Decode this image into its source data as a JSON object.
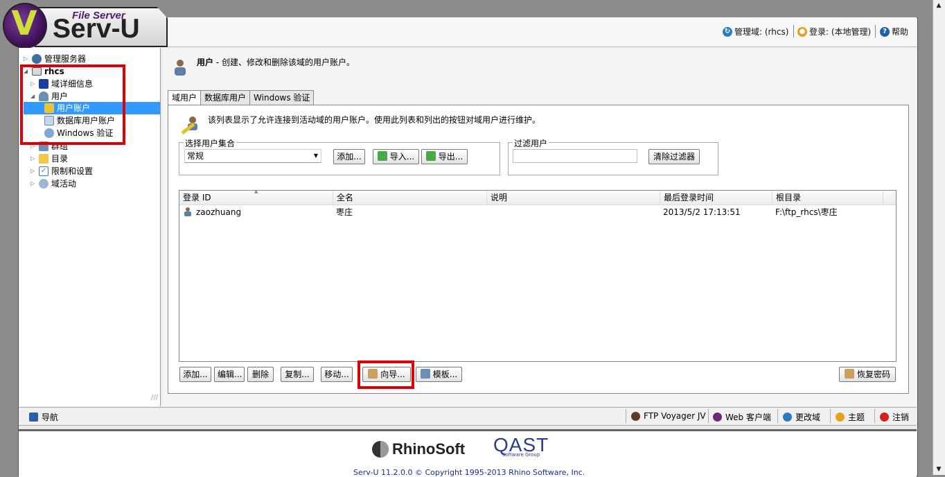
{
  "app": {
    "logo_small": "File Server",
    "logo_big": "Serv-U"
  },
  "header": {
    "domain_label": "管理域: (rhcs)",
    "login_label": "登录: (本地管理)",
    "help_label": "帮助"
  },
  "tree": {
    "items": [
      {
        "label": "管理服务器",
        "icon": "server-icon"
      },
      {
        "label": "rhcs",
        "icon": "domain-icon"
      },
      {
        "label": "域详细信息",
        "icon": "monitor-icon"
      },
      {
        "label": "用户",
        "icon": "user-icon"
      },
      {
        "label": "用户账户",
        "icon": "pencil-user-icon"
      },
      {
        "label": "数据库用户账户",
        "icon": "table-icon"
      },
      {
        "label": "Windows 验证",
        "icon": "windows-user-icon"
      },
      {
        "label": "群组",
        "icon": "group-icon"
      },
      {
        "label": "目录",
        "icon": "folder-icon"
      },
      {
        "label": "限制和设置",
        "icon": "checkbox-icon"
      },
      {
        "label": "域活动",
        "icon": "activity-icon"
      }
    ]
  },
  "page": {
    "title_bold": "用户",
    "title_rest": " - 创建、修改和删除该域的用户账户。"
  },
  "tabs": [
    "域用户",
    "数据库用户",
    "Windows 验证"
  ],
  "panel": {
    "description": "该列表显示了允许连接到活动域的用户账户。使用此列表和列出的按钮对域用户进行维护。",
    "collection_legend": "选择用户集合",
    "collection_value": "常规",
    "add_collection": "添加...",
    "import": "导入...",
    "export": "导出...",
    "filter_legend": "过滤用户",
    "filter_value": "",
    "clear_filter": "清除过滤器"
  },
  "table": {
    "columns": [
      "登录 ID",
      "全名",
      "说明",
      "最后登录时间",
      "根目录"
    ],
    "rows": [
      {
        "login": "zaozhuang",
        "fullname": "枣庄",
        "desc": "",
        "last_login": "2013/5/2 17:13:51",
        "root": "F:\\ftp_rhcs\\枣庄"
      }
    ]
  },
  "actions": {
    "add": "添加...",
    "edit": "编辑...",
    "delete": "删除",
    "copy": "复制...",
    "move": "移动...",
    "wizard": "向导...",
    "template": "模板...",
    "recover": "恢复密码"
  },
  "statusbar": {
    "nav": "导航",
    "ftp_voyager": "FTP Voyager JV",
    "web_client": "Web 客户端",
    "change_domain": "更改域",
    "theme": "主题",
    "logout": "注销"
  },
  "footer": {
    "rhino": "RhinoSoft",
    "qast": "QAST",
    "qast_sub": "Software Group",
    "copyright": "Serv-U 11.2.0.0 © Copyright 1995-2013  Rhino Software, Inc."
  },
  "colors": {
    "accent": "#3399ff",
    "highlight": "#e00000"
  }
}
